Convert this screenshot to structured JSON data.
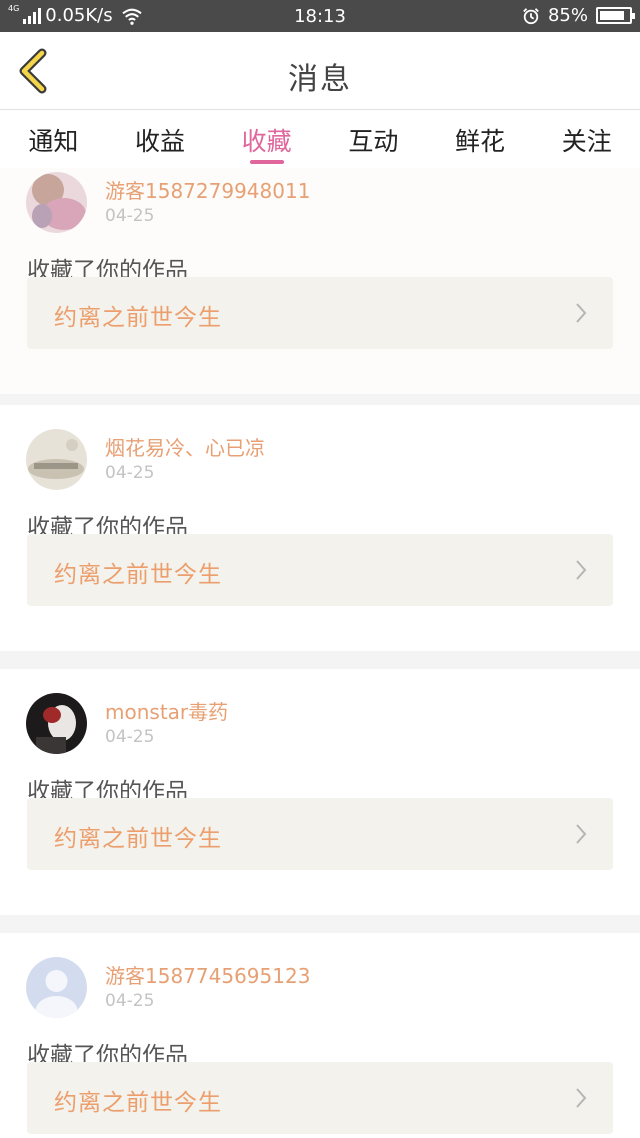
{
  "status_bar": {
    "network_type": "4G",
    "speed": "0.05K/s",
    "time": "18:13",
    "battery_percent": "85%",
    "battery_level": 0.85
  },
  "header": {
    "title": "消息"
  },
  "tabs": [
    {
      "label": "通知",
      "active": false
    },
    {
      "label": "收益",
      "active": false
    },
    {
      "label": "收藏",
      "active": true
    },
    {
      "label": "互动",
      "active": false
    },
    {
      "label": "鲜花",
      "active": false
    },
    {
      "label": "关注",
      "active": false
    }
  ],
  "colors": {
    "accent": "#e0679c",
    "username": "#e7a074",
    "work_title": "#ec9e6c"
  },
  "items": [
    {
      "username": "游客1587279948011",
      "date": "04-25",
      "action": "收藏了你的作品",
      "work_title": "约离之前世今生",
      "avatar_icon": "avatar-photo-pink"
    },
    {
      "username": "烟花易冷、心已凉",
      "date": "04-25",
      "action": "收藏了你的作品",
      "work_title": "约离之前世今生",
      "avatar_icon": "avatar-photo-text"
    },
    {
      "username": "monstar毒药",
      "date": "04-25",
      "action": "收藏了你的作品",
      "work_title": "约离之前世今生",
      "avatar_icon": "avatar-photo-dark"
    },
    {
      "username": "游客1587745695123",
      "date": "04-25",
      "action": "收藏了你的作品",
      "work_title": "约离之前世今生",
      "avatar_icon": "avatar-default-person"
    }
  ]
}
